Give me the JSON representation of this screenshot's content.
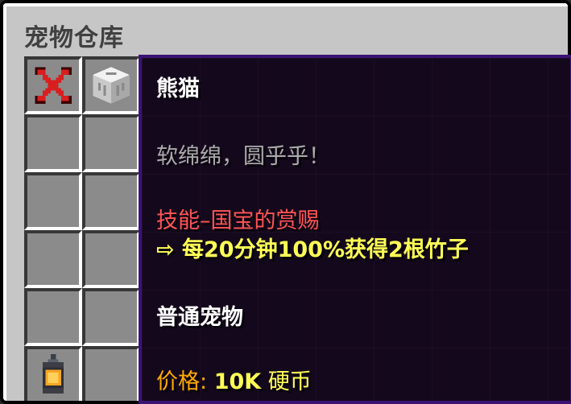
{
  "window": {
    "title": "宠物仓库"
  },
  "slots": {
    "close_icon": "red-x-icon",
    "pet_icon": "wool-block-icon",
    "lantern_icon": "lantern-icon"
  },
  "tooltip": {
    "name": "熊猫",
    "description": "软绵绵，圆乎乎！",
    "skill": "技能–国宝的赏赐",
    "effect": "⇨ 每20分钟100%获得2根竹子",
    "rarity": "普通宠物",
    "price_label": "价格:",
    "price_value": "10K",
    "price_unit": "硬币"
  },
  "colors": {
    "panel": "#c6c6c6",
    "slot": "#8b8b8b",
    "tooltip_bg": "#14091c",
    "tooltip_border": "#3c1374",
    "gray_text": "#aaaaaa",
    "red_text": "#ff5555",
    "yellow_text": "#ffff55",
    "gold_text": "#ffaa00"
  }
}
